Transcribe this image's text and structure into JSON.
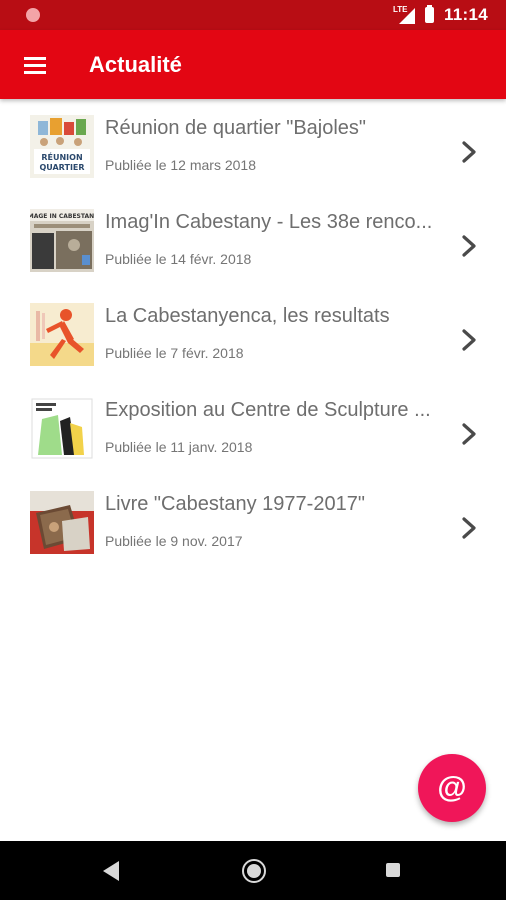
{
  "status_bar": {
    "network": "LTE",
    "time": "11:14"
  },
  "app_bar": {
    "title": "Actualité"
  },
  "news": [
    {
      "title": "Réunion de quartier \"Bajoles\"",
      "date": "Publiée le 12 mars 2018",
      "thumb": "reunion-quartier",
      "thumb_text": "RÉUNION QUARTIER"
    },
    {
      "title": "Imag'In Cabestany - Les 38e renco...",
      "date": "Publiée le 14 févr. 2018",
      "thumb": "imagin-cabestany",
      "thumb_text": "IMAGE IN CABESTANY"
    },
    {
      "title": "La Cabestanyenca, les resultats",
      "date": "Publiée le 7 févr. 2018",
      "thumb": "runner"
    },
    {
      "title": "Exposition au Centre de Sculpture ...",
      "date": "Publiée le 11 janv. 2018",
      "thumb": "sculpture"
    },
    {
      "title": "Livre \"Cabestany 1977-2017\"",
      "date": "Publiée le 9 nov. 2017",
      "thumb": "book"
    }
  ],
  "fab": {
    "icon": "@"
  },
  "colors": {
    "app_bar": "#e30613",
    "status_bar": "#b80d14",
    "fab": "#f01659"
  }
}
